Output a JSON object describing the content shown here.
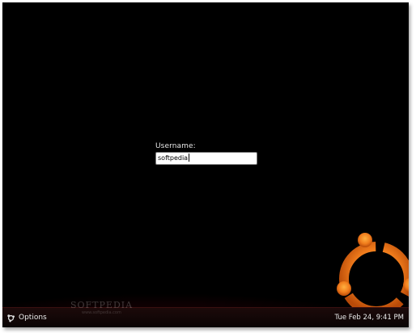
{
  "login": {
    "label": "Username:",
    "value": "softpedia"
  },
  "panel": {
    "options_label": "Options",
    "options_icon": "options-gear-icon",
    "clock": "Tue Feb 24,  9:41 PM"
  },
  "watermark": {
    "name": "SOFTPEDIA",
    "url": "www.softpedia.com"
  },
  "colors": {
    "background": "#000000",
    "accent_orange": "#f07c1c",
    "input_bg": "#ffffff",
    "text": "#e6e6e6"
  }
}
